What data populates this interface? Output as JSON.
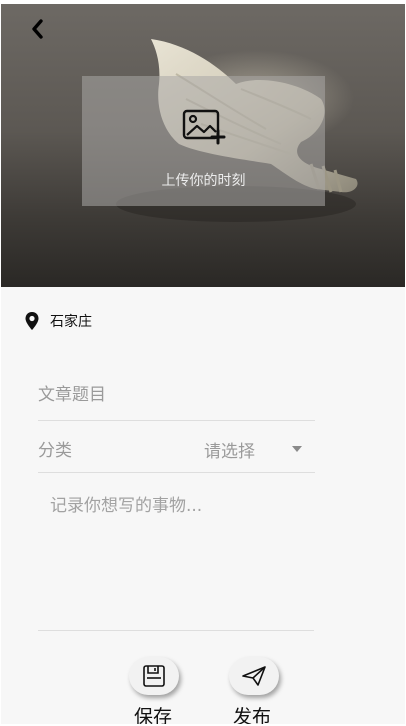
{
  "header": {
    "back_icon": "chevron-left-icon"
  },
  "upload": {
    "icon": "image-plus-icon",
    "label": "上传你的时刻"
  },
  "location": {
    "icon": "map-pin-icon",
    "city": "石家庄"
  },
  "form": {
    "title_placeholder": "文章题目",
    "category_label": "分类",
    "category_select_value": "请选择",
    "content_placeholder": "记录你想写的事物..."
  },
  "actions": {
    "save_icon": "floppy-disk-icon",
    "save_label": "保存",
    "publish_icon": "paper-plane-icon",
    "publish_label": "发布"
  },
  "colors": {
    "background": "#f7f7f7",
    "placeholder": "#9a9a9a",
    "divider": "#dedede"
  }
}
